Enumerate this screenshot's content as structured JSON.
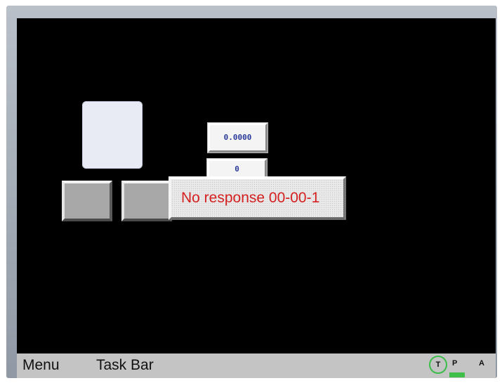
{
  "screen": {
    "display_value_1": "0.0000",
    "display_value_2": "0",
    "alarm_message": "No response 00-00-1"
  },
  "taskbar": {
    "menu_label": "Menu",
    "title": "Task Bar",
    "indicator_t": "T",
    "indicator_p": "P",
    "indicator_a": "A"
  },
  "colors": {
    "screen_background": "#000000",
    "alarm_text": "#d42020",
    "value_text": "#2a3a9a",
    "status_indicator": "#3bbd4a",
    "taskbar_background": "#c4c4c4"
  }
}
